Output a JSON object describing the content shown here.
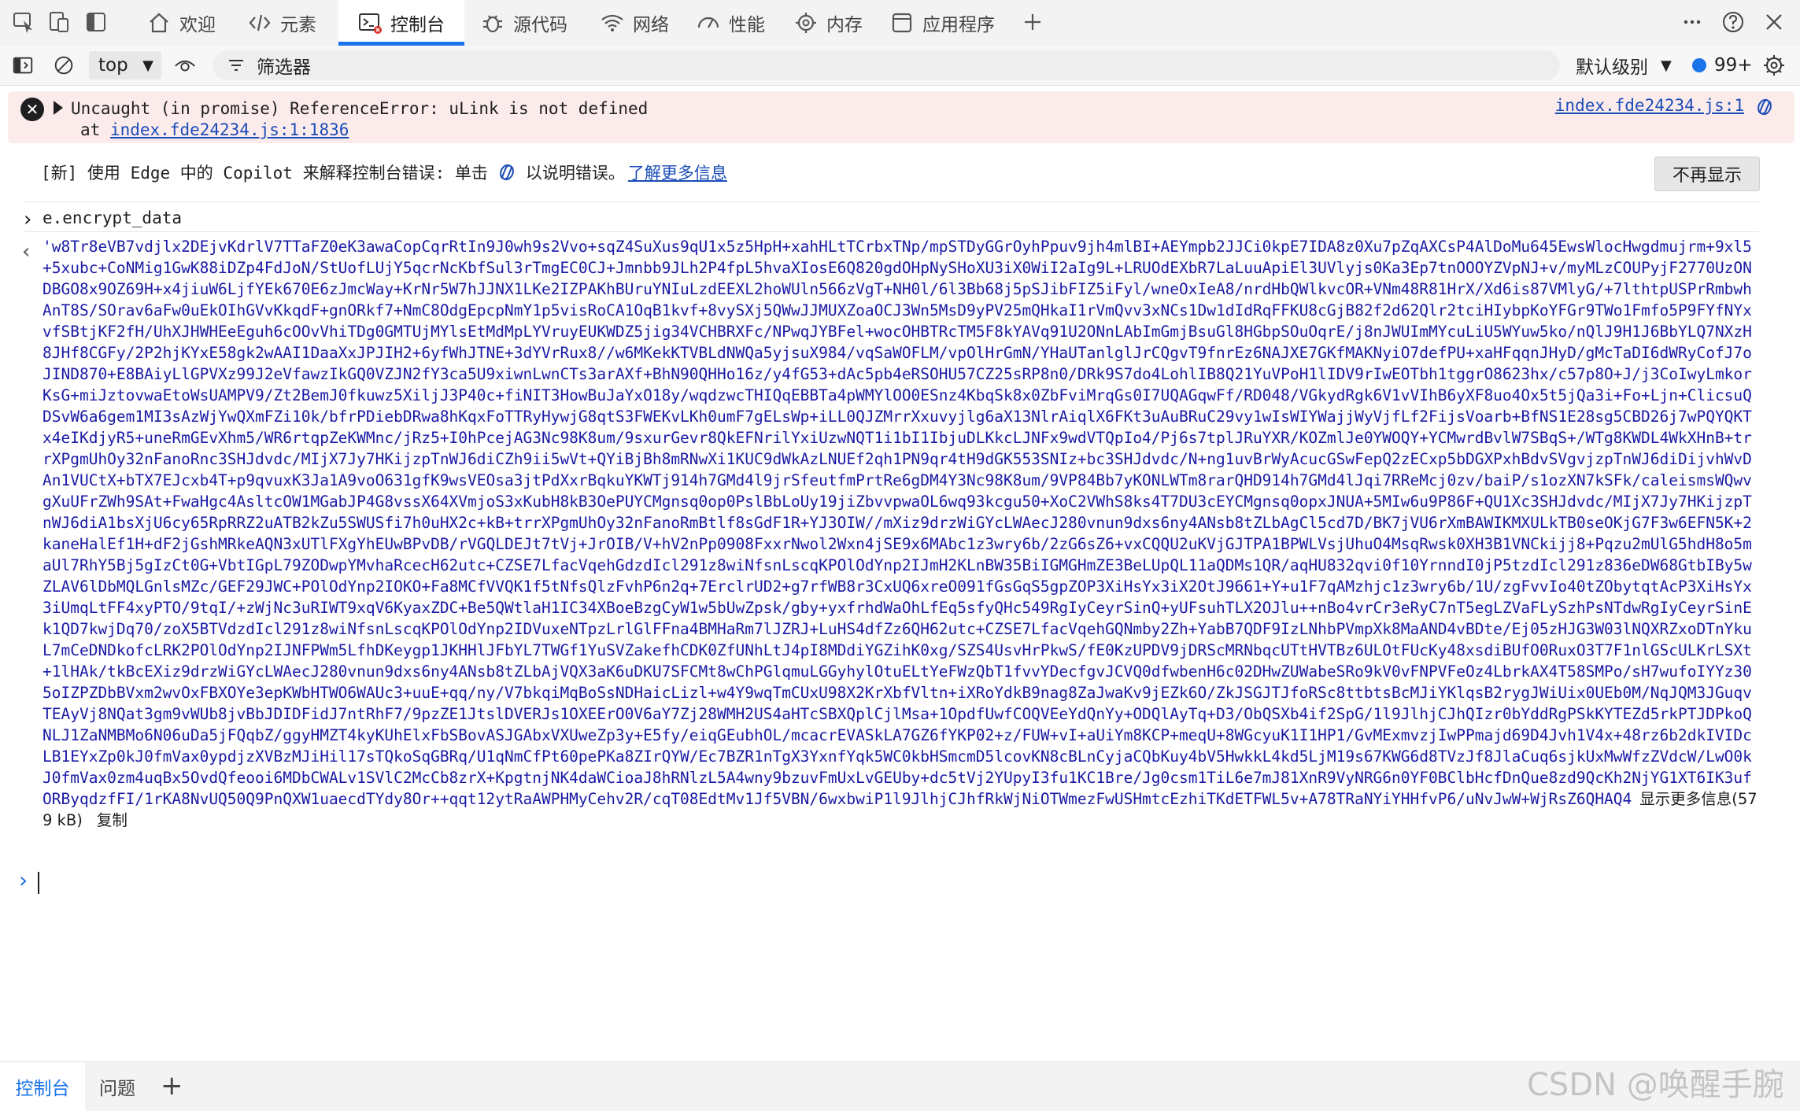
{
  "tabs": [
    {
      "label": "欢迎",
      "icon": "home-icon"
    },
    {
      "label": "元素",
      "icon": "code-icon"
    },
    {
      "label": "控制台",
      "icon": "console-icon",
      "active": true
    },
    {
      "label": "源代码",
      "icon": "bug-icon"
    },
    {
      "label": "网络",
      "icon": "wifi-icon"
    },
    {
      "label": "性能",
      "icon": "gauge-icon"
    },
    {
      "label": "内存",
      "icon": "gear-icon"
    },
    {
      "label": "应用程序",
      "icon": "window-icon"
    }
  ],
  "toolbar": {
    "context": "top",
    "filter_placeholder": "筛选器",
    "levels": "默认级别",
    "issues_count": "99+"
  },
  "error": {
    "message": "Uncaught (in promise) ReferenceError: uLink is not defined",
    "at_prefix": "at ",
    "at_link": "index.fde24234.js:1:1836",
    "source": "index.fde24234.js:1"
  },
  "hint": {
    "text_before": "[新] 使用 Edge 中的 Copilot 来解释控制台错误: 单击",
    "text_after": "以说明错误。",
    "link": "了解更多信息",
    "dismiss": "不再显示"
  },
  "console": {
    "input": "e.encrypt_data",
    "output_text": "'w8Tr8eVB7vdjlx2DEjvKdrlV7TTaFZ0eK3awaCopCqrRtIn9J0wh9s2Vvo+sqZ4SuXus9qU1x5z5HpH+xahHLtTCrbxTNp/mpSTDyGGrOyhPpuv9jh4mlBI+AEYmpb2JJCi0kpE7IDA8z0Xu7pZqAXCsP4AlDoMu645EwsWlocHwgdmujrm+9xl5+5xubc+CoNMig1GwK88iDZp4FdJoN/StUofLUjY5qcrNcKbfSul3rTmgEC0CJ+Jmnbb9JLh2P4fpL5hvaXIosE6Q820gdOHpNySHoXU3iX0WiI2aIg9L+LRUOdEXbR7LaLuuApiEl3UVlyjs0Ka3Ep7tnOOOYZVpNJ+v/myMLzCOUPyjF2770UzONDBGO8x9OZ69H+x4jiuW6LjfYEk670E6zJmcWay+KrNr5W7hJJNX1LKe2IZPAKhBUruYNIuLzdEEXL2hoWUln566zVgT+NH0l/6l3Bb68j5pSJibFIZ5iFyl/wneOxIeA8/nrdHbQWlkvcOR+VNm48R81HrX/Xd6is87VMlyG/+7lthtpUSPrRmbwhAnT8S/SOrav6aFw0uEkOIhGVvKkqdF+gnORkf7+NmC8OdgEpcpNmY1p5visRoCA1OqB1kvf+8vySXj5QWwJJMUXZoaOCJ3Wn5MsD9yPV25mQHkaI1rVmQvv3xNCs1Dw1dIdRqFFKU8cGjB82f2d62Qlr2tciHIybpKoYFGr9TWo1Fmfo5P9FYfNYxvfSBtjKF2fH/UhXJHWHEeEguh6cOOvVhiTDg0GMTUjMYlsEtMdMpLYVruyEUKWDZ5jig34VCHBRXFc/NPwqJYBFel+wocOHBTRcTM5F8kYAVq91U2ONnLAbImGmjBsuGl8HGbpSOuOqrE/j8nJWUImMYcuLiU5WYuw5ko/nQlJ9H1J6BbYLQ7NXzH8JHf8CGFy/2P2hjKYxE58gk2wAAI1DaaXxJPJIH2+6yfWhJTNE+3dYVrRux8//w6MKekKTVBLdNWQa5yjsuX984/vqSaWOFLM/vpOlHrGmN/YHaUTanlglJrCQgvT9fnrEz6NAJXE7GKfMAKNyiO7defPU+xaHFqqnJHyD/gMcTaDI6dWRyCofJ7oJIND870+E8BAiyLlGPVXz99J2eVfawzIkGQ0VZJN2fY3ca5U9xiwnLwnCTs3arAXf+BhN90QHHo16z/y4fG53+dAc5pb4eRSOHU57CZ25sRP8n0/DRk9S7do4LohlIB8Q21YuVPoH1lIDV9rIwEOTbh1tggrO8623hx/c57p8O+J/j3CoIwyLmkorKsG+miJztovwaEtoWsUAMPV9/Zt2BemJ0fkuwz5XiljJ3P40c+fiNIT3HowBuJaYxO18y/wqdzwcTHIQqEBBTa4pWMYlOO0ESnz4KbqSk8x0ZbFviMrqGs0I7UQAGqwFf/RD048/VGkydRgk6V1vVIhB6yXF8uo4Ox5t5jQa3i+Fo+Ljn+ClicsuQDSvW6a6gem1MI3sAzWjYwQXmFZi10k/bfrPDiebDRwa8hKqxFoTTRyHywjG8qtS3FWEKvLKh0umF7gELsWp+iLL0QJZMrrXxuvyjlg6aX13NlrAiqlX6FKt3uAuBRuC29vy1wIsWIYWajjWyVjfLf2FijsVoarb+BfNS1E28sg5CBD26j7wPQYQKTx4eIKdjyR5+uneRmGEvXhm5/WR6rtqpZeKWMnc/jRz5+I0hPcejAG3Nc98K8um/9sxurGevr8QkEFNrilYxiUzwNQT1i1bI1IbjuDLKkcLJNFx9wdVTQpIo4/Pj6s7tplJRuYXR/KOZmlJe0YWOQY+YCMwrdBvlW7SBqS+/WTg8KWDL4WkXHnB+trrXPgmUhOy32nFanoRnc3SHJdvdc/MIjX7Jy7HKijzpTnWJ6diCZh9ii5wVt+QYiBjBh8mRNwXi1KUC9dWkAzLNUEf2qh1PN9qr4tH9dGK553SNIz+bc3SHJdvdc/N+ng1uvBrWyAcucGSwFepQ2zECxp5bDGXPxhBdvSVgvjzpTnWJ6diDijvhWvDAn1VUCtX+bTX7EJcxb4T+p9qvuxK3Ja1A9voO631gfK9wsVEOsa3jtPdXxrBqkuYKWTj914h7GMd4l9jrSfeutfmPrtRe6gDM4Y3Nc98K8um/9VP84Bb7yKONLWTm8rarQHD914h7GMd4lJqi7RReMcj0zv/baiP/s1ozXN7kSFk/caleismsWQwvgXuUFrZWh9SAt+FwaHgc4AsltcOW1MGabJP4G8vssX64XVmjoS3xKubH8kB3OePUYCMgnsq0op0PslBbLoUy19jiZbvvpwaOL6wq93kcgu50+XoC2VWhS8ks4T7DU3cEYCMgnsq0opxJNUA+5MIw6u9P86F+QU1Xc3SHJdvdc/MIjX7Jy7HKijzpTnWJ6diA1bsXjU6cy65RpRRZ2uATB2kZu5SWUSfi7h0uHX2c+kB+trrXPgmUhOy32nFanoRmBtlf8sGdF1R+YJ3OIW//mXiz9drzWiGYcLWAecJ280vnun9dxs6ny4ANsb8tZLbAgCl5cd7D/BK7jVU6rXmBAWIKMXULkTB0seOKjG7F3w6EFN5K+2kaneHalEf1H+dF2jGshMRkeAQN3xUTlFXgYhEUwBPvDB/rVGQLDEJt7tVj+JrOIB/V+hV2nPp0908FxxrNwol2Wxn4jSE9x6MAbc1z3wry6b/2zG6sZ6+vxCQQU2uKVjGJTPA1BPWLVsjUhuO4MsqRwsk0XH3B1VNCkijj8+Pqzu2mUlG5hdH8o5maUl7RhY5Bj5gIzCt0G+VbtIGpL79ZODwpYMvhaRcecH62utc+CZSE7LfacVqehGdzdIcl291z8wiNfsnLscqKPOlOdYnp2IJmH2KLnBW35BiIGMGHmZE3BeLUpQL11aQDMs1QR/aqHU832qvi0f10YrnndI0jP5tzdIcl291z836eDW68GtbIBy5wZLAV6lDbMQLGnlsMZc/GEF29JWC+POlOdYnp2IOKO+Fa8MCfVVQK1f5tNfsQlzFvhP6n2q+7ErclrUD2+g7rfWB8r3CxUQ6xreO091fGsGqS5gpZOP3XiHsYx3iX2OtJ9661+Y+u1F7qAMzhjc1z3wry6b/1U/zgFvvIo40tZObytqtAcP3XiHsYx3iUmqLtFF4xyPTO/9tqI/+zWjNc3uRIWT9xqV6KyaxZDC+Be5QWtlaH1IC34XBoeBzgCyW1w5bUwZpsk/gby+yxfrhdWaOhLfEq5sfyQHc549RgIyCeyrSinQ+yUFsuhTLX2OJlu++nBo4vrCr3eRyC7nT5egLZVaFLySzhPsNTdwRgIyCeyrSinEk1QD7kwjDq70/zoX5BTVdzdIcl291z8wiNfsnLscqKPOlOdYnp2IDVuxeNTpzLrlGlFFna4BMHaRm7lJZRJ+LuHS4dfZz6QH62utc+CZSE7LfacVqehGQNmby2Zh+YabB7QDF9IzLNhbPVmpXk8MaAND4vBDte/Ej05zHJG3W03lNQXRZxoDTnYkuL7mCeDNDkofcLRK2POlOdYnp2IJNFPWm5LfhDKeygp1JKHHlJFbYL7TWGf1YuSVZakefhCDK0ZfUNhLtJ4pI8MDdiYGZihK0xg/SZS4UsvHrPkwS/fE0KzUPDV9jDRScMRNbqcUTtHVTBz6ULOtFUcKy48xsdiBUfO0RuxO3T7F1nlGScULKrLSXt+1lHAk/tkBcEXiz9drzWiGYcLWAecJ280vnun9dxs6ny4ANsb8tZLbAjVQX3aK6uDKU7SFCMt8wChPGlqmuLGGyhylOtuELtYeFWzQbT1fvvYDecfgvJCVQ0dfwbenH6c02DHwZUWabeSRo9kV0vFNPVFeOz4LbrkAX4T58SMPo/sH7wufoIYYz305oIZPZDbBVxm2wvOxFBXOYe3epKWbHTWO6WAUc3+uuE+qq/ny/V7bkqiMqBoSsNDHaicLizl+w4Y9wqTmCUxU98X2KrXbfVltn+iXRoYdkB9nag8ZaJwaKv9jEZk6O/ZkJSGJTJfoRSc8ttbtsBcMJiYKlqsB2rygJWiUix0UEb0M/NqJQM3JGuqvTEAyVj8NQat3gm9vWUb8jvBbJDIDFidJ7ntRhF7/9pzZE1JtslDVERJs1OXEErO0V6aY7Zj28WMH2US4aHTcSBXQplCjlMsa+1OpdfUwfCOQVEeYdQnYy+ODQlAyTq+D3/ObQSXb4if2SpG/1l9JlhjCJhQIzr0bYddRgPSkKYTEZd5rkPTJDPkoQNLJ1ZaNMBMo6N06uDa5jFQqbZ/ggyHMZT4kyKUhElxFbSBovASJGAbxVXUweZp3y+E5fy/eiqGEubhOL/mcacrEVASkLA7GZ6fYKP02+z/FUW+vI+aUiYm8KCP+meqU+8WGcyuK1I1HP1/GvMExmvzjIwPPmajd69D4Jvh1V4x+48rz6b2dkIVIDcLB1EYxZp0kJ0fmVax0ypdjzXVBzMJiHil17sTQkoSqGBRq/U1qNmCfPt60pePKa8ZIrQYW/Ec7BZR1nTgX3YxnfYqk5WC0kbHSmcmD5lcovKN8cBLnCyjaCQbKuy4bV5HwkkL4kd5LjM19s67KWG6d8TVzJf8JlaCuq6sjkUxMwWfzZVdcW/LwO0kJ0fmVax0zm4uqBx5OvdQfeooi6MDbCWALv1SVlC2McCb8zrX+KpgtnjNK4daWCioaJ8hRNlzL5A4wny9bzuvFmUxLvGEUby+dc5tVj2YUpyI3fu1KC1Bre/Jg0csm1TiL6e7mJ81XnR9VyNRG6n0YF0BClbHcfDnQue8zd9QcKh2NjYG1XT6IK3ufORByqdzfFI/1rKA8NvUQ50Q9PnQXW1uaecdTYdy8Or++qqt12ytRaAWPHMyCehv2R/cqT08EdtMv1Jf5VBN/6wxbwiP1l9JlhjCJhfRkWjNiOTWmezFwUSHmtcEzhiTKdETFWL5v+A78TRaNYiYHHfvP6/uNvJwW+WjRsZ6QHAQ4",
    "show_more": "显示更多信息(579 kB)",
    "copy": "复制"
  },
  "drawer": {
    "tabs": [
      {
        "label": "控制台",
        "active": true
      },
      {
        "label": "问题"
      }
    ]
  },
  "watermark": "CSDN @唤醒手腕"
}
